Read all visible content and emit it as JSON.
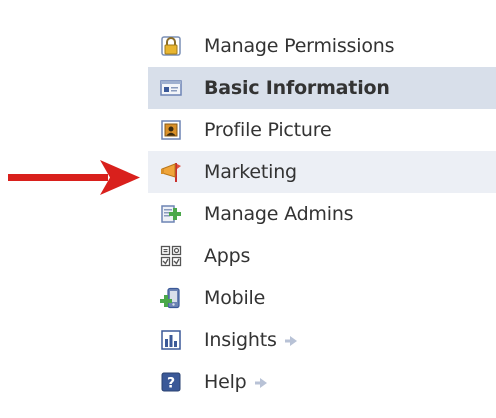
{
  "sidebar": {
    "items": [
      {
        "id": "manage-permissions",
        "label": "Manage Permissions",
        "icon": "lock-icon"
      },
      {
        "id": "basic-information",
        "label": "Basic Information",
        "icon": "id-card-icon",
        "selected": true
      },
      {
        "id": "profile-picture",
        "label": "Profile Picture",
        "icon": "picture-frame-icon"
      },
      {
        "id": "marketing",
        "label": "Marketing",
        "icon": "megaphone-flag-icon",
        "hovered": true
      },
      {
        "id": "manage-admins",
        "label": "Manage Admins",
        "icon": "add-admin-icon"
      },
      {
        "id": "apps",
        "label": "Apps",
        "icon": "apps-grid-icon"
      },
      {
        "id": "mobile",
        "label": "Mobile",
        "icon": "mobile-plus-icon"
      },
      {
        "id": "insights",
        "label": "Insights",
        "icon": "bar-chart-icon",
        "external_arrow": true
      },
      {
        "id": "help",
        "label": "Help",
        "icon": "question-icon",
        "external_arrow": true
      }
    ]
  },
  "annotation": {
    "pointer": "red-arrow-icon",
    "color": "#d9201c"
  },
  "colors": {
    "selected_bg": "#d8dfea",
    "hover_bg": "#eceff5",
    "text": "#333333"
  }
}
